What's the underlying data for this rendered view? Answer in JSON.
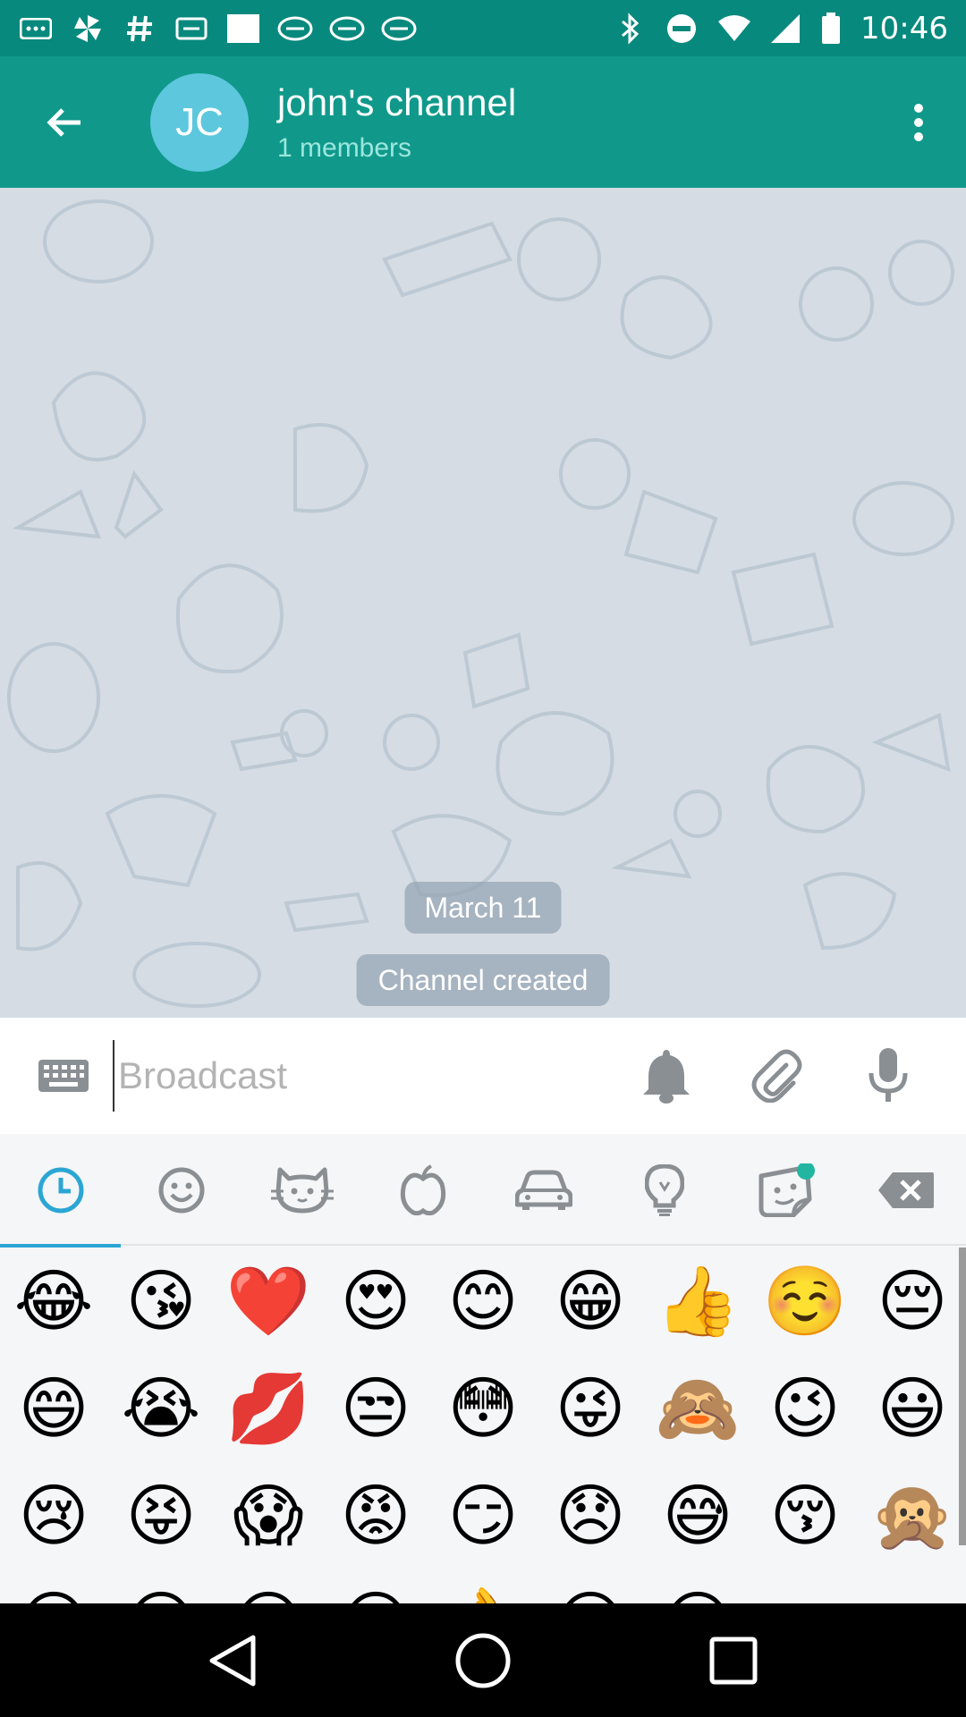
{
  "status_bar": {
    "time": "10:46",
    "notification_icons": [
      "grid-dots-icon",
      "pinwheel-icon",
      "hashtag-icon",
      "ticket-icon",
      "blank-card-icon",
      "news-icon",
      "news-icon",
      "news-icon"
    ],
    "system_icons": [
      "bluetooth-icon",
      "do-not-disturb-icon",
      "wifi-icon",
      "signal-icon",
      "battery-icon"
    ]
  },
  "header": {
    "avatar_initials": "JC",
    "title": "john's channel",
    "subtitle": "1 members",
    "colors": {
      "bar": "#10998b",
      "avatar": "#5cc7dd",
      "subtitle": "#9be6de"
    }
  },
  "chat": {
    "date_label": "March 11",
    "service_message": "Channel created",
    "background": "#d5dce4"
  },
  "composer": {
    "placeholder": "Broadcast",
    "value": ""
  },
  "emoji_panel": {
    "tabs": [
      {
        "name": "recent",
        "icon": "clock-icon",
        "active": true
      },
      {
        "name": "smileys",
        "icon": "smiley-icon",
        "active": false
      },
      {
        "name": "animals",
        "icon": "cat-icon",
        "active": false
      },
      {
        "name": "food",
        "icon": "apple-icon",
        "active": false
      },
      {
        "name": "travel",
        "icon": "car-icon",
        "active": false
      },
      {
        "name": "objects",
        "icon": "lightbulb-icon",
        "active": false
      },
      {
        "name": "stickers",
        "icon": "sticker-icon",
        "active": false
      },
      {
        "name": "delete",
        "icon": "backspace-icon",
        "active": false
      }
    ],
    "accent": "#2ba6d4",
    "emojis": [
      "😂",
      "😘",
      "❤️",
      "😍",
      "😊",
      "😁",
      "👍",
      "☺️",
      "😔",
      "😄",
      "😭",
      "💋",
      "😒",
      "😳",
      "😜",
      "🙈",
      "😉",
      "😃",
      "😢",
      "😝",
      "😱",
      "😡",
      "😏",
      "😞",
      "😅",
      "😚",
      "🙊",
      "😀",
      "😌",
      "😋",
      "😎",
      "👌",
      "😐",
      "😆",
      "",
      ""
    ]
  }
}
